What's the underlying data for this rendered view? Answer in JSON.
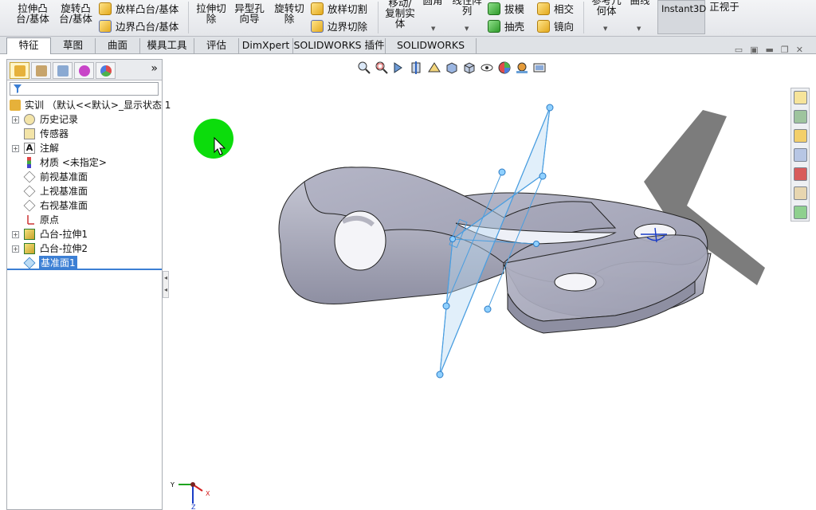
{
  "ribbon": {
    "extrude_boss": "拉伸凸\n台/基体",
    "revolve_boss": "旋转凸\n台/基体",
    "loft_boss": "放样凸台/基体",
    "boundary_boss": "边界凸台/基体",
    "extrude_cut": "拉伸切\n除",
    "hole_wizard": "异型孔\n向导",
    "revolve_cut": "旋转切\n除",
    "loft_cut": "放样切割",
    "boundary_cut": "边界切除",
    "move_copy": "移动/\n复制实\n体",
    "fillet": "圆角",
    "linear_pattern": "线性阵\n列",
    "draft": "拔模",
    "shell": "抽壳",
    "intersect": "相交",
    "mirror": "镜向",
    "ref_geometry": "参考几\n何体",
    "curves": "曲线",
    "instant3d": "Instant3D",
    "normal_to": "正视于"
  },
  "tabs": [
    "特征",
    "草图",
    "曲面",
    "模具工具",
    "评估",
    "DimXpert",
    "SOLIDWORKS 插件",
    "SOLIDWORKS MBD"
  ],
  "active_tab": "特征",
  "feature_tree": {
    "root": "实训 （默认<<默认>_显示状态 1",
    "items": [
      {
        "label": "历史记录",
        "icon": "history-icon"
      },
      {
        "label": "传感器",
        "icon": "sensor-icon"
      },
      {
        "label": "注解",
        "icon": "annotation-icon"
      },
      {
        "label": "材质 <未指定>",
        "icon": "material-icon"
      },
      {
        "label": "前视基准面",
        "icon": "plane-icon"
      },
      {
        "label": "上视基准面",
        "icon": "plane-icon"
      },
      {
        "label": "右视基准面",
        "icon": "plane-icon"
      },
      {
        "label": "原点",
        "icon": "origin-icon"
      },
      {
        "label": "凸台-拉伸1",
        "icon": "boss-extrude-icon"
      },
      {
        "label": "凸台-拉伸2",
        "icon": "boss-extrude-icon"
      },
      {
        "label": "基准面1",
        "icon": "plane-icon",
        "selected": true
      }
    ]
  },
  "triad": {
    "x_label": "X",
    "y_label": "Y",
    "z_label": "Z"
  },
  "colors": {
    "accent": "#3c7fd4",
    "cursor_highlight": "#0cdc0c",
    "part": "#a9aabb",
    "plane": "#bcdcf5"
  }
}
